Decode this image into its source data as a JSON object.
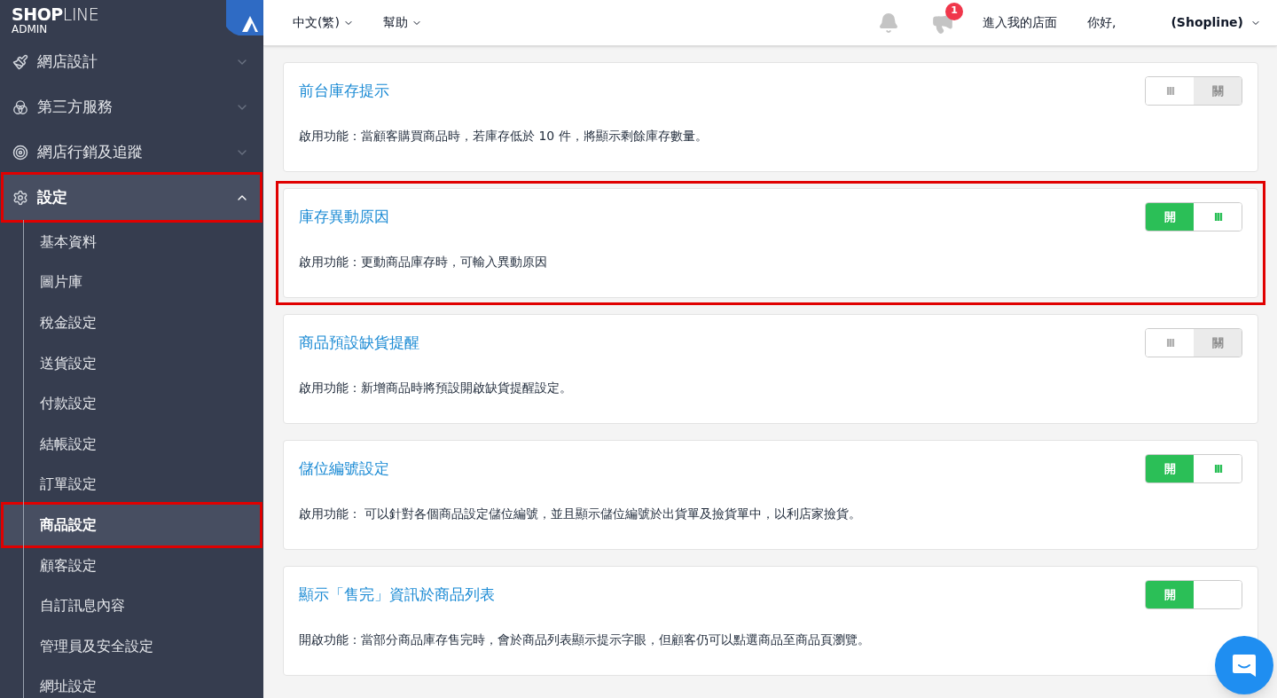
{
  "brand": {
    "name_bold": "SHOP",
    "name_light": "LINE",
    "subtitle": "ADMIN"
  },
  "sidebar": {
    "items": [
      {
        "label": "網店設計",
        "expanded": false,
        "selected": false,
        "highlighted": false
      },
      {
        "label": "第三方服務",
        "expanded": false,
        "selected": false,
        "highlighted": false
      },
      {
        "label": "網店行銷及追蹤",
        "expanded": false,
        "selected": false,
        "highlighted": false
      },
      {
        "label": "設定",
        "expanded": true,
        "selected": true,
        "highlighted": true,
        "children": [
          {
            "label": "基本資料",
            "selected": false,
            "highlighted": false
          },
          {
            "label": "圖片庫",
            "selected": false,
            "highlighted": false
          },
          {
            "label": "稅金設定",
            "selected": false,
            "highlighted": false
          },
          {
            "label": "送貨設定",
            "selected": false,
            "highlighted": false
          },
          {
            "label": "付款設定",
            "selected": false,
            "highlighted": false
          },
          {
            "label": "結帳設定",
            "selected": false,
            "highlighted": false
          },
          {
            "label": "訂單設定",
            "selected": false,
            "highlighted": false
          },
          {
            "label": "商品設定",
            "selected": true,
            "highlighted": true
          },
          {
            "label": "顧客設定",
            "selected": false,
            "highlighted": false
          },
          {
            "label": "自訂訊息內容",
            "selected": false,
            "highlighted": false
          },
          {
            "label": "管理員及安全設定",
            "selected": false,
            "highlighted": false
          },
          {
            "label": "網址設定",
            "selected": false,
            "highlighted": false
          }
        ]
      }
    ]
  },
  "header": {
    "language": "中文(繁)",
    "help": "幫助",
    "notification_badge": "1",
    "store_link": "進入我的店面",
    "greeting": "你好,",
    "account": "(Shopline)"
  },
  "settings": [
    {
      "title": "前台庫存提示",
      "description": "啟用功能：當顧客購買商品時，若庫存低於 10 件，將顯示剩餘庫存數量。",
      "on": false,
      "highlighted": false,
      "off_label": "關",
      "handle": "III"
    },
    {
      "title": "庫存異動原因",
      "description": "啟用功能：更動商品庫存時，可輸入異動原因",
      "on": true,
      "highlighted": true,
      "on_label": "開",
      "handle": "III"
    },
    {
      "title": "商品預設缺貨提醒",
      "description": "啟用功能：新增商品時將預設開啟缺貨提醒設定。",
      "on": false,
      "highlighted": false,
      "off_label": "關",
      "handle": "III"
    },
    {
      "title": "儲位編號設定",
      "description": "啟用功能： 可以針對各個商品設定儲位編號，並且顯示儲位編號於出貨單及撿貨單中，以利店家撿貨。",
      "on": true,
      "highlighted": false,
      "on_label": "開",
      "handle": "III"
    },
    {
      "title": "顯示「售完」資訊於商品列表",
      "description": "開啟功能：當部分商品庫存售完時，會於商品列表顯示提示字眼，但顧客仍可以點選商品至商品頁瀏覽。",
      "on": true,
      "highlighted": false,
      "on_label": "開"
    }
  ]
}
